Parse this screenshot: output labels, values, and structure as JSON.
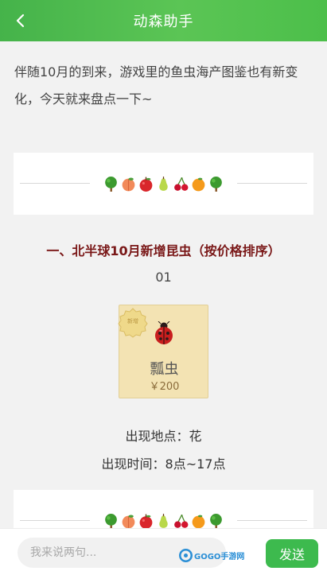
{
  "header": {
    "title": "动森助手"
  },
  "article": {
    "intro": "伴随10月的到来，游戏里的鱼虫海产图鉴也有新变化，今天就来盘点一下~",
    "section_heading": "一、北半球10月新增昆虫（按价格排序）",
    "item": {
      "number": "01",
      "name": "瓢虫",
      "price": "￥200",
      "badge_text": "新增",
      "location": "出现地点：花",
      "time": "出现时间：8点~17点"
    }
  },
  "divider": {
    "icons": [
      "tree-icon",
      "peach-icon",
      "apple-icon",
      "pear-icon",
      "cherry-icon",
      "orange-icon",
      "tree-icon"
    ]
  },
  "footer": {
    "comment_placeholder": "我来说两句...",
    "send_label": "发送",
    "watermark": "GOGO手游网"
  },
  "colors": {
    "header_green": "#4cbf4a",
    "heading_red": "#7a1818",
    "send_green": "#3dba4e"
  }
}
